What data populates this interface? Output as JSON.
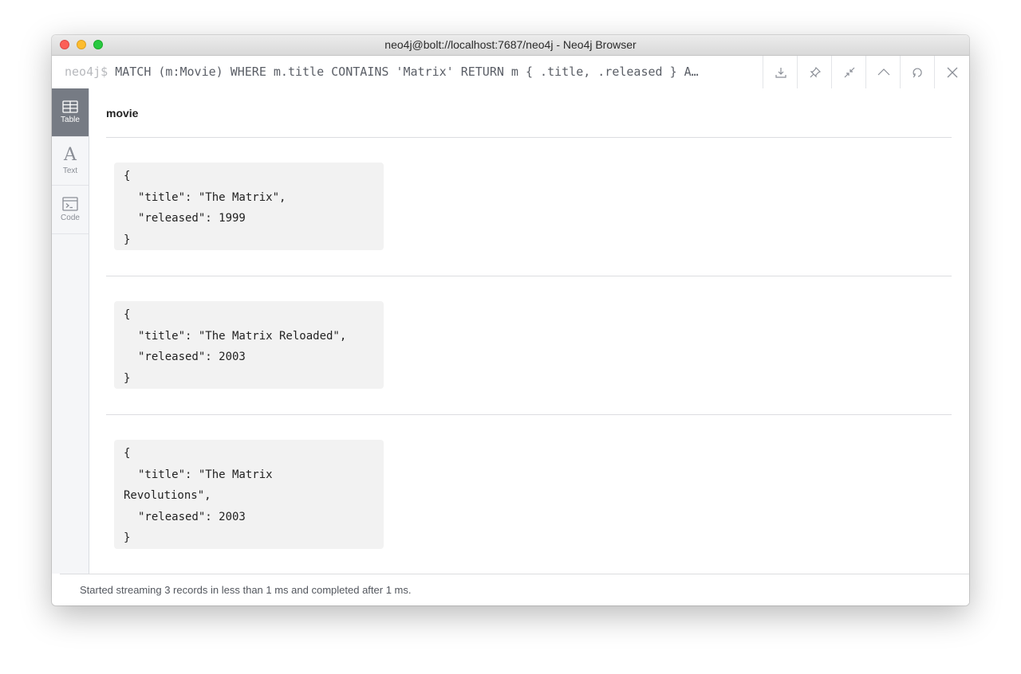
{
  "window": {
    "title": "neo4j@bolt://localhost:7687/neo4j - Neo4j Browser"
  },
  "query": {
    "prompt": "neo4j$",
    "text": "MATCH (m:Movie) WHERE m.title CONTAINS 'Matrix' RETURN m { .title, .released } A…"
  },
  "toolbar": {
    "buttons": [
      "download-icon",
      "pin-icon",
      "collapse-icon",
      "chevron-up-icon",
      "rerun-icon",
      "close-icon"
    ]
  },
  "sidebar": {
    "items": [
      {
        "label": "Table",
        "icon": "table-icon",
        "active": true
      },
      {
        "label": "Text",
        "icon": "text-icon",
        "active": false
      },
      {
        "label": "Code",
        "icon": "code-icon",
        "active": false
      }
    ]
  },
  "result": {
    "column": "movie",
    "records": [
      {
        "open": "{",
        "title_line": "\"title\": \"The Matrix\",",
        "released_line": "\"released\": 1999",
        "close": "}"
      },
      {
        "open": "{",
        "title_line": "\"title\": \"The Matrix Reloaded\",",
        "released_line": "\"released\": 2003",
        "close": "}"
      },
      {
        "open": "{",
        "title_line": "\"title\": \"The Matrix",
        "title_line_cont": "Revolutions\",",
        "released_line": "\"released\": 2003",
        "close": "}"
      }
    ]
  },
  "status": {
    "message": "Started streaming 3 records in less than 1 ms and completed after 1 ms."
  },
  "colors": {
    "active_tab": "#767b84",
    "record_bg": "#f2f2f2",
    "close_light": "#fc5f57",
    "minimize_light": "#fdbc2e",
    "maximize_light": "#28c940"
  }
}
